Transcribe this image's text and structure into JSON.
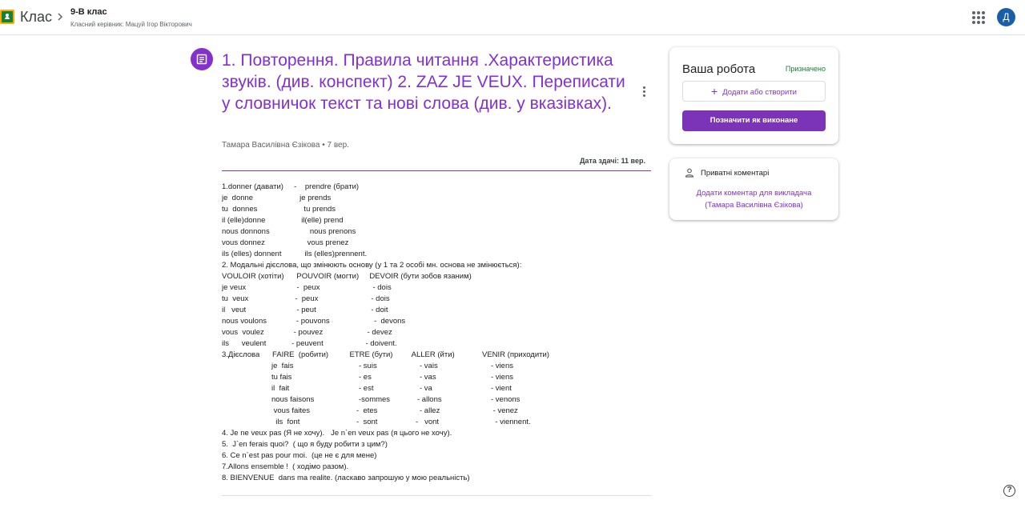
{
  "app": {
    "name": "Клас"
  },
  "header": {
    "class_title": "9-В клас",
    "class_subtitle": "Класний керівник: Мацуй Ігор Вікторович",
    "avatar_letter": "Д"
  },
  "assignment": {
    "title": "1. Повторення. Правила читання .Характеристика звуків. (див. конспект)   2.  ZAZ JE VEUX.  Переписати у словничок текст та нові слова (див. у вказівках).",
    "author": "Тамара Василівна Єзікова",
    "posted": "7 вер.",
    "due": "Дата здачі: 11 вер."
  },
  "instructions": {
    "lines": [
      "1.donner (давати)     -    prendre (брати)",
      "je  donne                      je prends",
      "tu  donnes                      tu prends",
      "il (elle)donne                 il(elle) prend",
      "nous donnons                   nous prenons",
      "vous donnez                    vous prenez",
      "ils (elles) donnent           ils (elles)prennent.",
      "2. Модальні дієслова, що змінюють основу (у 1 та 2 особі мн. основа не змінюється):",
      "VOULOIR (хотіти)      POUVOIR (могти)     DEVOIR (бути зобов язаним)",
      "je veux                        -  peux                         - dois",
      "tu  veux                      -  peux                         - dois",
      "il   veut                        - peut                          - doit",
      "nous voulons              - pouvons                     -  devons",
      "vous  voulez              - pouvez                     - devez",
      "ils      veulent            - peuvent                    - doivent.",
      "3.Дієслова      FAIRE  (робити)          ETRE (бути)         ALLER (йти)             VENIR (приходити)"
    ],
    "conjugations": [
      [
        "je  fais",
        "- suis",
        "- vais",
        "- viens"
      ],
      [
        "tu fais",
        "- es",
        "- vas",
        "- viens"
      ],
      [
        "il  fait",
        "- est",
        "- va",
        "- vient"
      ],
      [
        "nous faisons",
        "-sommes",
        "- allons",
        "- venons"
      ],
      [
        " vous faites",
        "-  etes",
        "- allez",
        " - venez"
      ],
      [
        "  ils  font",
        "-  sont",
        "-   vont",
        "  - viennent."
      ]
    ],
    "phrases": [
      "4. Je ne veux pas (Я не хочу).   Je n`en veux pas (я цього не хочу).",
      "5.  J`en ferais quoi?  ( що я буду робити з цим?)",
      "6. Ce n`est pas pour moi.  (це не є для мене)",
      "7.Allons ensemble !  ( ходімо разом).",
      "8. BIENVENUE  dans ma realite. (ласкаво запрошую у мою реальність)"
    ]
  },
  "work_card": {
    "title": "Ваша робота",
    "status": "Призначено",
    "add_label": "Додати або створити",
    "mark_done_label": "Позначити як виконане"
  },
  "comments_card": {
    "title": "Приватні коментарі",
    "link_line1": "Додати коментар для викладача",
    "link_line2": "(Тамара Василівна Єзікова)"
  },
  "colors": {
    "accent": "#8430ce",
    "status_green": "#188038",
    "avatar_blue": "#1a5ea8"
  },
  "icons": [
    "classroom-logo-icon",
    "chevron-right-icon",
    "apps-grid-icon",
    "assignment-icon",
    "more-vert-icon",
    "plus-icon",
    "person-icon",
    "help-icon"
  ]
}
